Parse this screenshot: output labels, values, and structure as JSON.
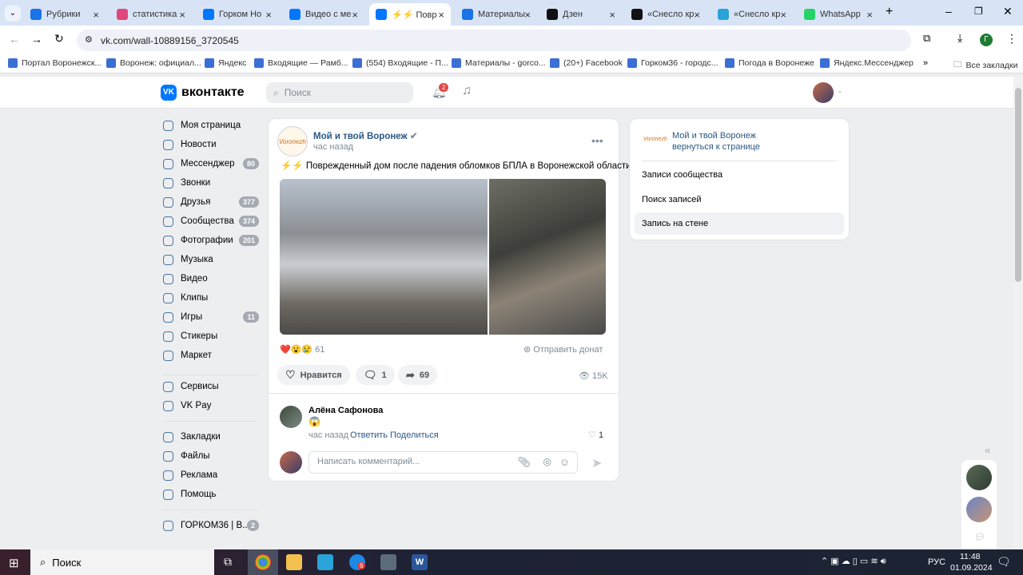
{
  "browser": {
    "tabs": [
      {
        "title": "Рубрики",
        "icon": "doc-icon"
      },
      {
        "title": "статистика",
        "icon": "chart-icon"
      },
      {
        "title": "Горком Но",
        "icon": "vk-icon"
      },
      {
        "title": "Видео с ме",
        "icon": "vk-icon"
      },
      {
        "title": "⚡⚡ Повр",
        "icon": "vk-icon",
        "active": true
      },
      {
        "title": "Материалы",
        "icon": "doc-icon"
      },
      {
        "title": "Дзен",
        "icon": "dzen-icon"
      },
      {
        "title": "«Снесло кр",
        "icon": "dzen-icon"
      },
      {
        "title": "«Снесло кр",
        "icon": "site-icon"
      },
      {
        "title": "WhatsApp",
        "icon": "whatsapp-icon"
      }
    ],
    "url": "vk.com/wall-10889156_3720545",
    "profile_letter": "Г",
    "bookmarks": [
      "Портал Воронежск...",
      "Воронеж: официал...",
      "Яндекс",
      "Входящие — Рамб...",
      "(554) Входящие - П...",
      "Материалы - gorco...",
      "(20+) Facebook",
      "Горком36 - городс...",
      "Погода в Воронеже",
      "Яндекс.Мессенджер"
    ],
    "all_bookmarks": "Все закладки"
  },
  "vk": {
    "logo": "вконтакте",
    "search_placeholder": "Поиск",
    "notif_count": "2",
    "accent": "#0077ff",
    "sidebar": [
      {
        "label": "Моя страница"
      },
      {
        "label": "Новости"
      },
      {
        "label": "Мессенджер",
        "count": "80"
      },
      {
        "label": "Звонки"
      },
      {
        "label": "Друзья",
        "count": "377"
      },
      {
        "label": "Сообщества",
        "count": "374"
      },
      {
        "label": "Фотографии",
        "count": "201"
      },
      {
        "label": "Музыка"
      },
      {
        "label": "Видео"
      },
      {
        "label": "Клипы"
      },
      {
        "label": "Игры",
        "count": "11"
      },
      {
        "label": "Стикеры"
      },
      {
        "label": "Маркет"
      },
      {
        "label": "Сервисы"
      },
      {
        "label": "VK Pay"
      },
      {
        "label": "Закладки"
      },
      {
        "label": "Файлы"
      },
      {
        "label": "Реклама"
      },
      {
        "label": "Помощь"
      },
      {
        "label": "ГОРКОМ36 | В...",
        "count": "2"
      }
    ],
    "post": {
      "author": "Мой и твой Воронеж",
      "time": "час назад",
      "text": "⚡⚡ Поврежденный дом после падения обломков БПЛА в Воронежской области",
      "reactions": "61",
      "donate": "Отправить донат",
      "like_label": "Нравится",
      "comments": "1",
      "shares": "69",
      "views": "15K",
      "comment": {
        "author": "Алёна Сафонова",
        "text": "😱",
        "time": "час назад",
        "reply": "Ответить",
        "share": "Поделиться",
        "likes": "1"
      },
      "comment_placeholder": "Написать комментарий..."
    },
    "right": {
      "group": "Мой и твой Воронеж",
      "back": "вернуться к странице",
      "items": [
        "Записи сообщества",
        "Поиск записей",
        "Запись на стене"
      ]
    }
  },
  "taskbar": {
    "search": "Поиск",
    "lang": "РУС",
    "time": "11:48",
    "date": "01.09.2024",
    "badge": "6"
  }
}
